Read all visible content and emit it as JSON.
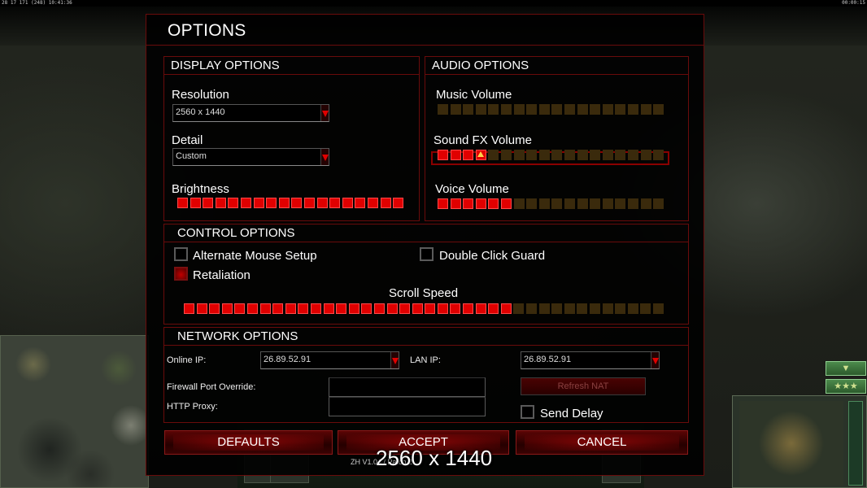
{
  "topbar": {
    "left_stats": "28 17 171 (248) 10:41:36",
    "right_time": "00:00:15"
  },
  "dialog": {
    "title": "OPTIONS",
    "display": {
      "header": "DISPLAY OPTIONS",
      "resolution_label": "Resolution",
      "resolution_value": "2560 x 1440",
      "detail_label": "Detail",
      "detail_value": "Custom",
      "brightness_label": "Brightness",
      "brightness_level": 18,
      "brightness_max": 18
    },
    "audio": {
      "header": "AUDIO OPTIONS",
      "music_label": "Music Volume",
      "music_level": 0,
      "music_max": 18,
      "sfx_label": "Sound FX Volume",
      "sfx_level": 4,
      "sfx_max": 18,
      "voice_label": "Voice Volume",
      "voice_level": 6,
      "voice_max": 18
    },
    "control": {
      "header": "CONTROL OPTIONS",
      "alt_mouse_label": "Alternate Mouse Setup",
      "alt_mouse_checked": false,
      "double_click_label": "Double Click Guard",
      "double_click_checked": false,
      "retaliation_label": "Retaliation",
      "retaliation_checked": true,
      "scroll_label": "Scroll Speed",
      "scroll_level": 26,
      "scroll_max": 38
    },
    "network": {
      "header": "NETWORK OPTIONS",
      "online_ip_label": "Online IP:",
      "online_ip_value": "26.89.52.91",
      "lan_ip_label": "LAN IP:",
      "lan_ip_value": "26.89.52.91",
      "firewall_label": "Firewall Port Override:",
      "firewall_value": "",
      "proxy_label": "HTTP Proxy:",
      "proxy_value": "",
      "refresh_nat_label": "Refresh NAT",
      "send_delay_label": "Send Delay",
      "send_delay_checked": false
    },
    "buttons": {
      "defaults": "DEFAULTS",
      "accept": "ACCEPT",
      "cancel": "CANCEL"
    },
    "version_text": "ZH V1.04 / Patch 2"
  },
  "overlay_resolution": "2560 x 1440",
  "colors": {
    "accent_red": "#e00000",
    "border_red": "#6a0b0b",
    "inactive_segment": "#3a2a0c",
    "thumb_yellow": "#ffd24a"
  }
}
